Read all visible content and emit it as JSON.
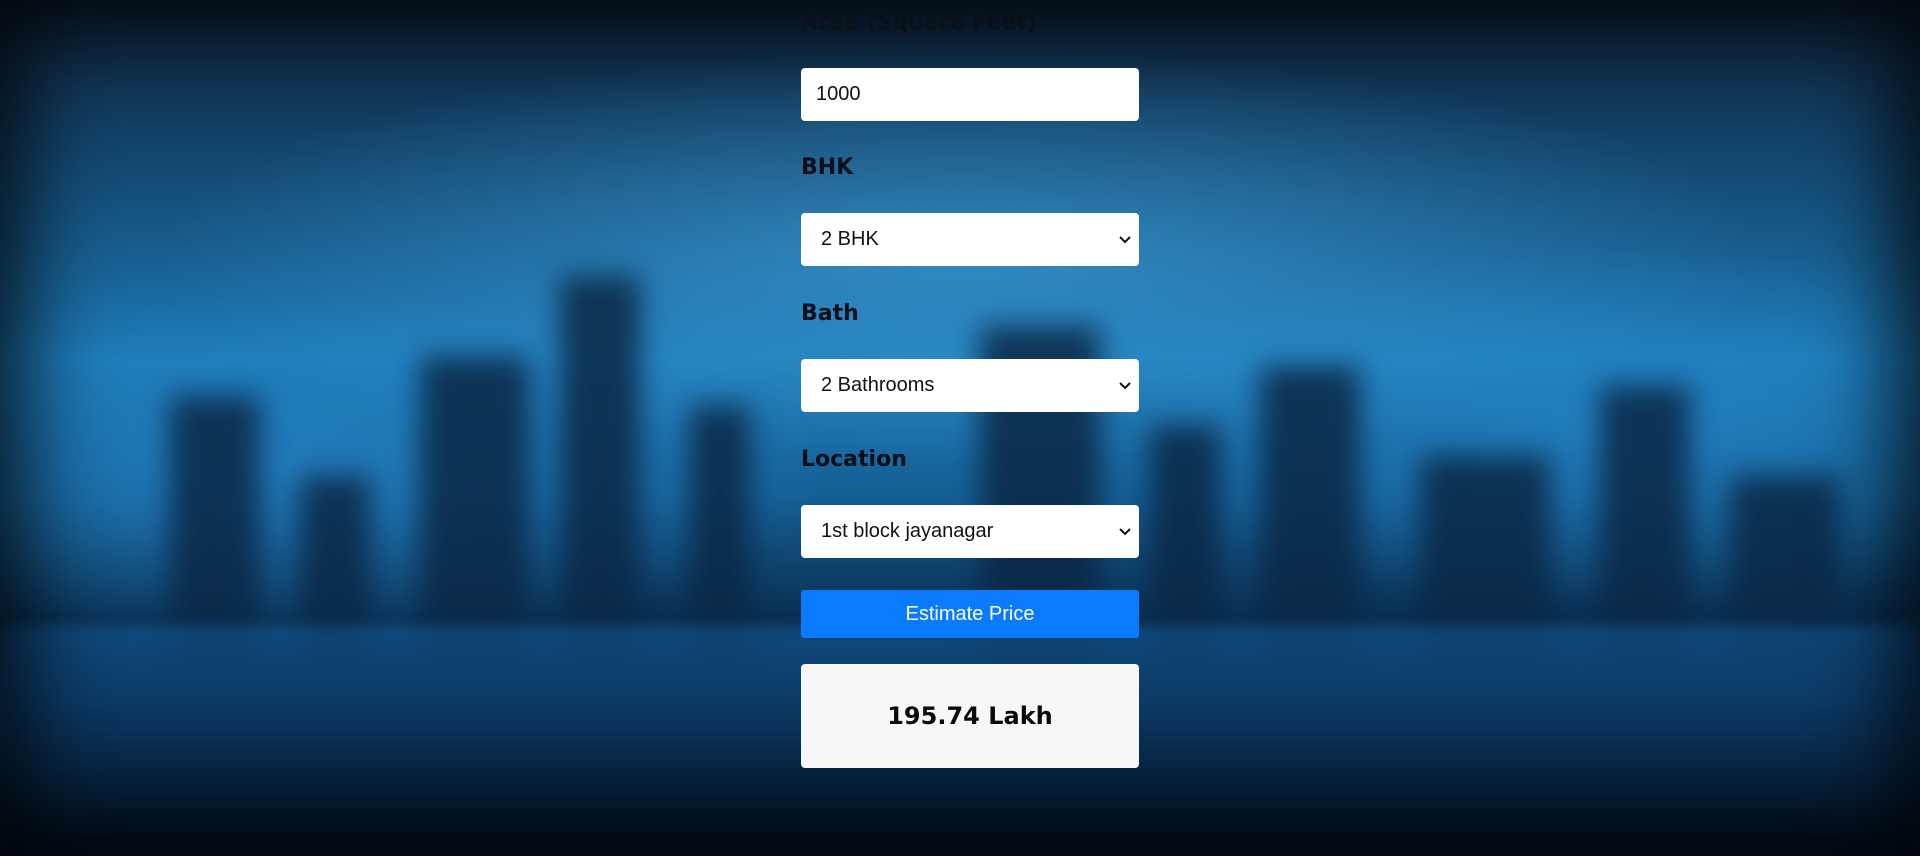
{
  "form": {
    "area": {
      "label": "Area (Square Feet)",
      "value": "1000"
    },
    "bhk": {
      "label": "BHK",
      "selected": "2 BHK"
    },
    "bath": {
      "label": "Bath",
      "selected": "2 Bathrooms"
    },
    "location": {
      "label": "Location",
      "selected": "1st block jayanagar"
    },
    "submit_label": "Estimate Price"
  },
  "result": {
    "text": "195.74 Lakh"
  },
  "colors": {
    "button": "#0a7bff",
    "result_bg": "#f7f7f7",
    "background": "#1d7ab6"
  },
  "icons": {
    "select_arrow": "chevron-down-icon"
  }
}
